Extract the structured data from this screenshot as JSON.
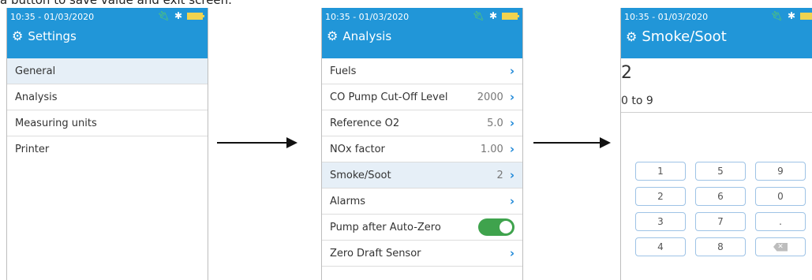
{
  "caption": "a button to save value and exit screen.",
  "status": {
    "time": "10:35 - 01/03/2020"
  },
  "icons": {
    "plug": "plug-icon",
    "bluetooth": "bluetooth-icon",
    "battery": "battery-icon",
    "gear": "gear-icon",
    "chevron": "chevron-right-icon",
    "backspace": "backspace-icon"
  },
  "screen1": {
    "title": "Settings",
    "items": [
      {
        "label": "General"
      },
      {
        "label": "Analysis"
      },
      {
        "label": "Measuring units"
      },
      {
        "label": "Printer"
      }
    ]
  },
  "screen2": {
    "title": "Analysis",
    "items": [
      {
        "label": "Fuels",
        "value": ""
      },
      {
        "label": "CO Pump Cut-Off Level",
        "value": "2000"
      },
      {
        "label": "Reference O2",
        "value": "5.0"
      },
      {
        "label": "NOx factor",
        "value": "1.00"
      },
      {
        "label": "Smoke/Soot",
        "value": "2"
      },
      {
        "label": "Alarms",
        "value": ""
      },
      {
        "label": "Pump after Auto-Zero",
        "value": ""
      },
      {
        "label": "Zero Draft Sensor",
        "value": ""
      }
    ],
    "toggle_on": true
  },
  "screen3": {
    "title": "Smoke/Soot",
    "value": "2",
    "range": "0 to 9",
    "keys": [
      "1",
      "5",
      "9",
      "2",
      "6",
      "0",
      "3",
      "7",
      ".",
      "4",
      "8"
    ]
  },
  "colors": {
    "header": "#2196d8",
    "accent": "#1e88d8",
    "selected_row": "#e6eff7",
    "toggle": "#3fa34d"
  }
}
